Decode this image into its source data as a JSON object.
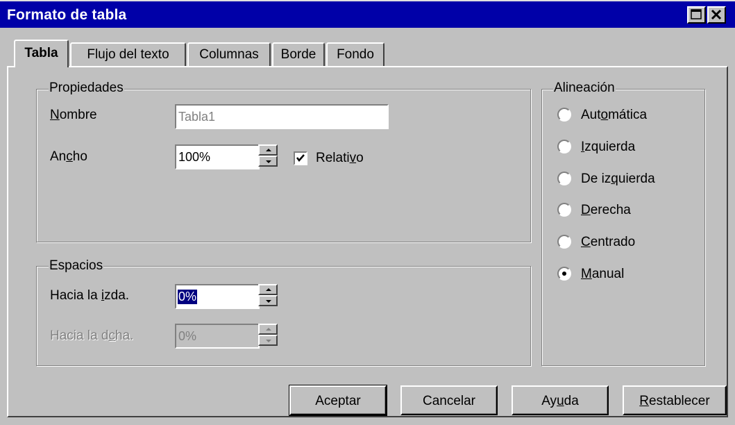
{
  "window": {
    "title": "Formato de tabla"
  },
  "tabs": [
    {
      "label": "Tabla"
    },
    {
      "label": "Flujo del texto"
    },
    {
      "label": "Columnas"
    },
    {
      "label": "Borde"
    },
    {
      "label": "Fondo"
    }
  ],
  "propiedades": {
    "legend": "Propiedades",
    "nombre_label": "Nombre",
    "nombre_value": "Tabla1",
    "ancho_label": "Ancho",
    "ancho_value": "100%",
    "relativo_label": "Relativo",
    "relativo_checked": true
  },
  "espacios": {
    "legend": "Espacios",
    "izda_label": "Hacia la izda.",
    "izda_value": "0%",
    "dcha_label": "Hacia la dcha.",
    "dcha_value": "0%"
  },
  "alineacion": {
    "legend": "Alineación",
    "options": [
      {
        "label": "Automática",
        "selected": false
      },
      {
        "label": "Izquierda",
        "selected": false
      },
      {
        "label": "De izquierda",
        "selected": false
      },
      {
        "label": "Derecha",
        "selected": false
      },
      {
        "label": "Centrado",
        "selected": false
      },
      {
        "label": "Manual",
        "selected": true
      }
    ]
  },
  "buttons": {
    "ok": "Aceptar",
    "cancel": "Cancelar",
    "help": "Ayuda",
    "reset": "Restablecer"
  },
  "colors": {
    "titlebar": "#0000a8",
    "face": "#c0c0c0",
    "selection": "#000080"
  }
}
